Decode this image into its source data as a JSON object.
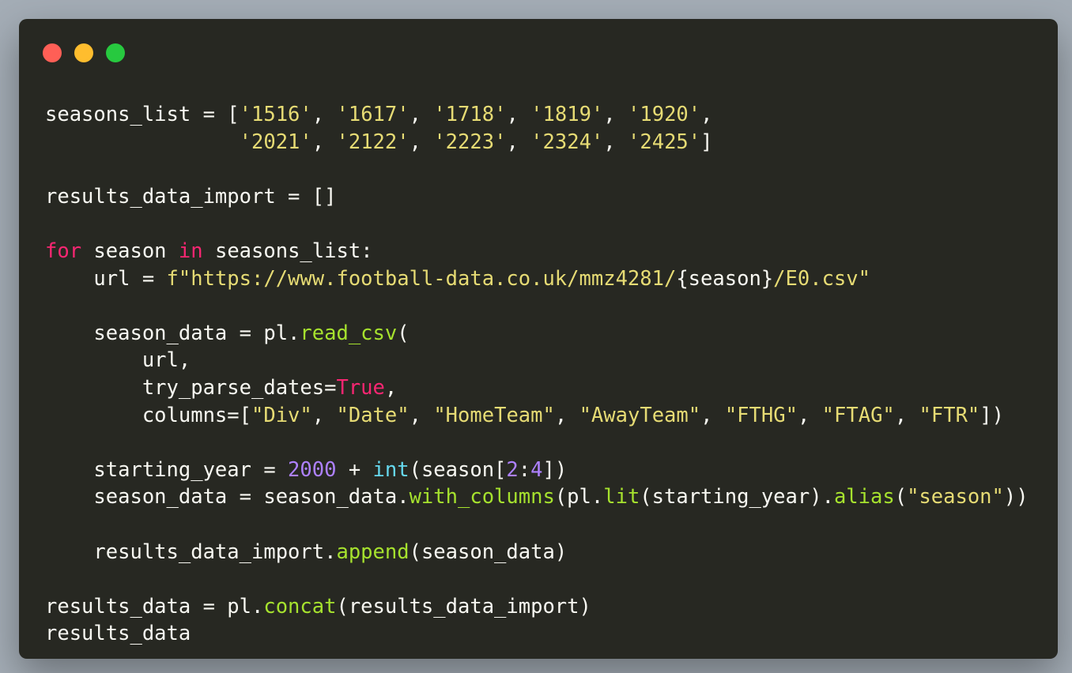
{
  "window": {
    "controls": {
      "close_color": "#ff5f56",
      "minimize_color": "#ffbd2e",
      "maximize_color": "#27c93f"
    }
  },
  "theme": {
    "background": "#272822",
    "text": "#f8f8f2",
    "string": "#e6db74",
    "keyword": "#f92672",
    "function": "#a6e22e",
    "number": "#ae81ff",
    "builtin": "#66d9ef"
  },
  "code": {
    "lines": [
      [
        [
          "seasons_list = [",
          "plain"
        ],
        [
          "'1516'",
          "str"
        ],
        [
          ", ",
          "plain"
        ],
        [
          "'1617'",
          "str"
        ],
        [
          ", ",
          "plain"
        ],
        [
          "'1718'",
          "str"
        ],
        [
          ", ",
          "plain"
        ],
        [
          "'1819'",
          "str"
        ],
        [
          ", ",
          "plain"
        ],
        [
          "'1920'",
          "str"
        ],
        [
          ",",
          "plain"
        ]
      ],
      [
        [
          "                ",
          "plain"
        ],
        [
          "'2021'",
          "str"
        ],
        [
          ", ",
          "plain"
        ],
        [
          "'2122'",
          "str"
        ],
        [
          ", ",
          "plain"
        ],
        [
          "'2223'",
          "str"
        ],
        [
          ", ",
          "plain"
        ],
        [
          "'2324'",
          "str"
        ],
        [
          ", ",
          "plain"
        ],
        [
          "'2425'",
          "str"
        ],
        [
          "]",
          "plain"
        ]
      ],
      [],
      [
        [
          "results_data_import = []",
          "plain"
        ]
      ],
      [],
      [
        [
          "for",
          "kw"
        ],
        [
          " season ",
          "plain"
        ],
        [
          "in",
          "kw"
        ],
        [
          " seasons_list:",
          "plain"
        ]
      ],
      [
        [
          "    url = ",
          "plain"
        ],
        [
          "f\"https://www.football-data.co.uk/mmz4281/",
          "str"
        ],
        [
          "{season}",
          "plain"
        ],
        [
          "/E0.csv\"",
          "str"
        ]
      ],
      [],
      [
        [
          "    season_data = pl.",
          "plain"
        ],
        [
          "read_csv",
          "fn"
        ],
        [
          "(",
          "plain"
        ]
      ],
      [
        [
          "        url,",
          "plain"
        ]
      ],
      [
        [
          "        try_parse_dates=",
          "plain"
        ],
        [
          "True",
          "kw"
        ],
        [
          ",",
          "plain"
        ]
      ],
      [
        [
          "        columns=[",
          "plain"
        ],
        [
          "\"Div\"",
          "str"
        ],
        [
          ", ",
          "plain"
        ],
        [
          "\"Date\"",
          "str"
        ],
        [
          ", ",
          "plain"
        ],
        [
          "\"HomeTeam\"",
          "str"
        ],
        [
          ", ",
          "plain"
        ],
        [
          "\"AwayTeam\"",
          "str"
        ],
        [
          ", ",
          "plain"
        ],
        [
          "\"FTHG\"",
          "str"
        ],
        [
          ", ",
          "plain"
        ],
        [
          "\"FTAG\"",
          "str"
        ],
        [
          ", ",
          "plain"
        ],
        [
          "\"FTR\"",
          "str"
        ],
        [
          "])",
          "plain"
        ]
      ],
      [],
      [
        [
          "    starting_year = ",
          "plain"
        ],
        [
          "2000",
          "num"
        ],
        [
          " + ",
          "plain"
        ],
        [
          "int",
          "bi"
        ],
        [
          "(season[",
          "plain"
        ],
        [
          "2",
          "num"
        ],
        [
          ":",
          "plain"
        ],
        [
          "4",
          "num"
        ],
        [
          "])",
          "plain"
        ]
      ],
      [
        [
          "    season_data = season_data.",
          "plain"
        ],
        [
          "with_columns",
          "fn"
        ],
        [
          "(pl.",
          "plain"
        ],
        [
          "lit",
          "fn"
        ],
        [
          "(starting_year).",
          "plain"
        ],
        [
          "alias",
          "fn"
        ],
        [
          "(",
          "plain"
        ],
        [
          "\"season\"",
          "str"
        ],
        [
          "))",
          "plain"
        ]
      ],
      [],
      [
        [
          "    results_data_import.",
          "plain"
        ],
        [
          "append",
          "fn"
        ],
        [
          "(season_data)",
          "plain"
        ]
      ],
      [],
      [
        [
          "results_data = pl.",
          "plain"
        ],
        [
          "concat",
          "fn"
        ],
        [
          "(results_data_import)",
          "plain"
        ]
      ],
      [
        [
          "results_data",
          "plain"
        ]
      ]
    ]
  }
}
